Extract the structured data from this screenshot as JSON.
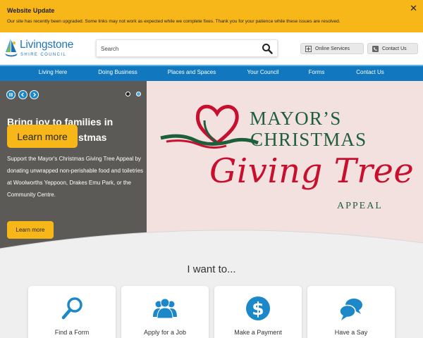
{
  "alert": {
    "title": "Website Update",
    "message": "Our site has recently been upgraded. Some links may not work as expected while we complete fixes. Thank you for your patience while these issues are resolved.",
    "close": "✕"
  },
  "header": {
    "logo_title": "Livingstone",
    "logo_sub": "SHIRE COUNCIL",
    "search_placeholder": "Search",
    "online_services": "Online Services",
    "contact_us": "Contact Us"
  },
  "nav": {
    "items": [
      "Living Here",
      "Doing Business",
      "Places and Spaces",
      "Your Council",
      "Forms",
      "Contact Us"
    ]
  },
  "hero": {
    "heading": "Bring joy to families in",
    "heading_tail": "stmas",
    "learn_more_big": "Learn more",
    "body": "Support the Mayor's Christmas Giving Tree Appeal by donating unwrapped non-perishable food and toiletries at Woolworths Yeppoon, Drakes Emu Park, or the Community Centre.",
    "learn_more_small": "Learn more",
    "slide_count": 2,
    "active_slide": 2,
    "banner": {
      "mayors": "MAYOR’S",
      "christmas": "CHRISTMAS",
      "giving_tree": "Giving Tree",
      "appeal": "APPEAL"
    }
  },
  "iwant": {
    "title": "I want to...",
    "cards": [
      {
        "label": "Find a Form",
        "icon": "magnifier-icon"
      },
      {
        "label": "Apply for a Job",
        "icon": "people-icon"
      },
      {
        "label": "Make a Payment",
        "icon": "dollar-icon"
      },
      {
        "label": "Have a Say",
        "icon": "speech-bubbles-icon"
      }
    ]
  },
  "colors": {
    "alert": "#f7b718",
    "nav": "#1177be",
    "accent_blue": "#1c87c9",
    "hero_panel": "#5b5a57",
    "button": "#f7b718"
  }
}
